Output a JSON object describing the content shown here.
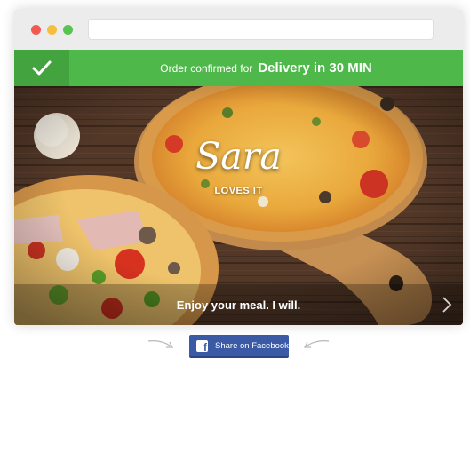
{
  "banner": {
    "prefix": "Order confirmed for",
    "highlight": "Delivery in 30 MIN",
    "icon": "checkmark-icon",
    "color": "#4fb84b"
  },
  "hero": {
    "name": "Sara",
    "tagline": "LOVES IT",
    "caption": "Enjoy your meal. I will.",
    "next_icon": "chevron-right-icon"
  },
  "share": {
    "button_label": "Share on Facebook",
    "icon": "facebook-icon",
    "color": "#3b5aa6"
  }
}
